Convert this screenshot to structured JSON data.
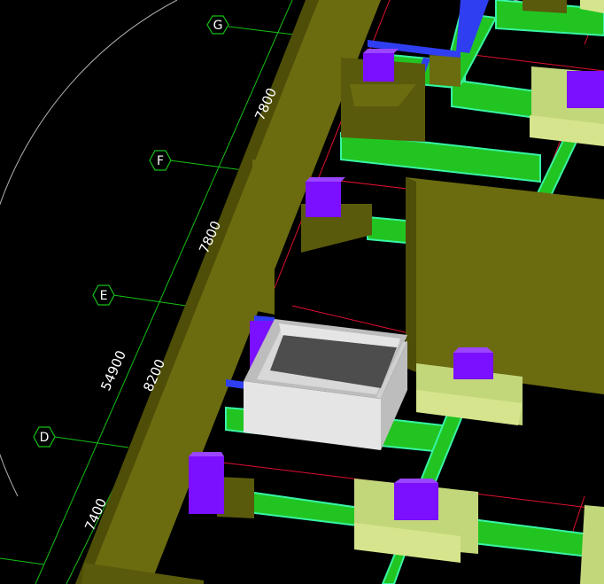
{
  "app": {
    "view": "3D model viewport"
  },
  "grid_axes": [
    {
      "label": "G"
    },
    {
      "label": "F"
    },
    {
      "label": "E"
    },
    {
      "label": "D"
    }
  ],
  "dimensions": {
    "total": "54900",
    "segments": [
      "7800",
      "7800",
      "8200",
      "7400"
    ]
  },
  "colors": {
    "background": "#000000",
    "wall": "#6b6b10",
    "wall_dark": "#4e4e08",
    "beam_green": "#22c422",
    "beam_green_edge": "#38f5a5",
    "pedestal": "#c2d77a",
    "pedestal_top": "#d6e58d",
    "pedestal_side": "#8b9950",
    "purple_block": "#7a10ff",
    "blue_beam": "#2f3ef0",
    "red_line": "#e01030",
    "grid_line": "#15c015",
    "tank_light": "#e5e5e5",
    "tank_mid": "#bdbdbd",
    "tank_dark": "#4d4d4d",
    "arc": "#b0b0b0"
  }
}
